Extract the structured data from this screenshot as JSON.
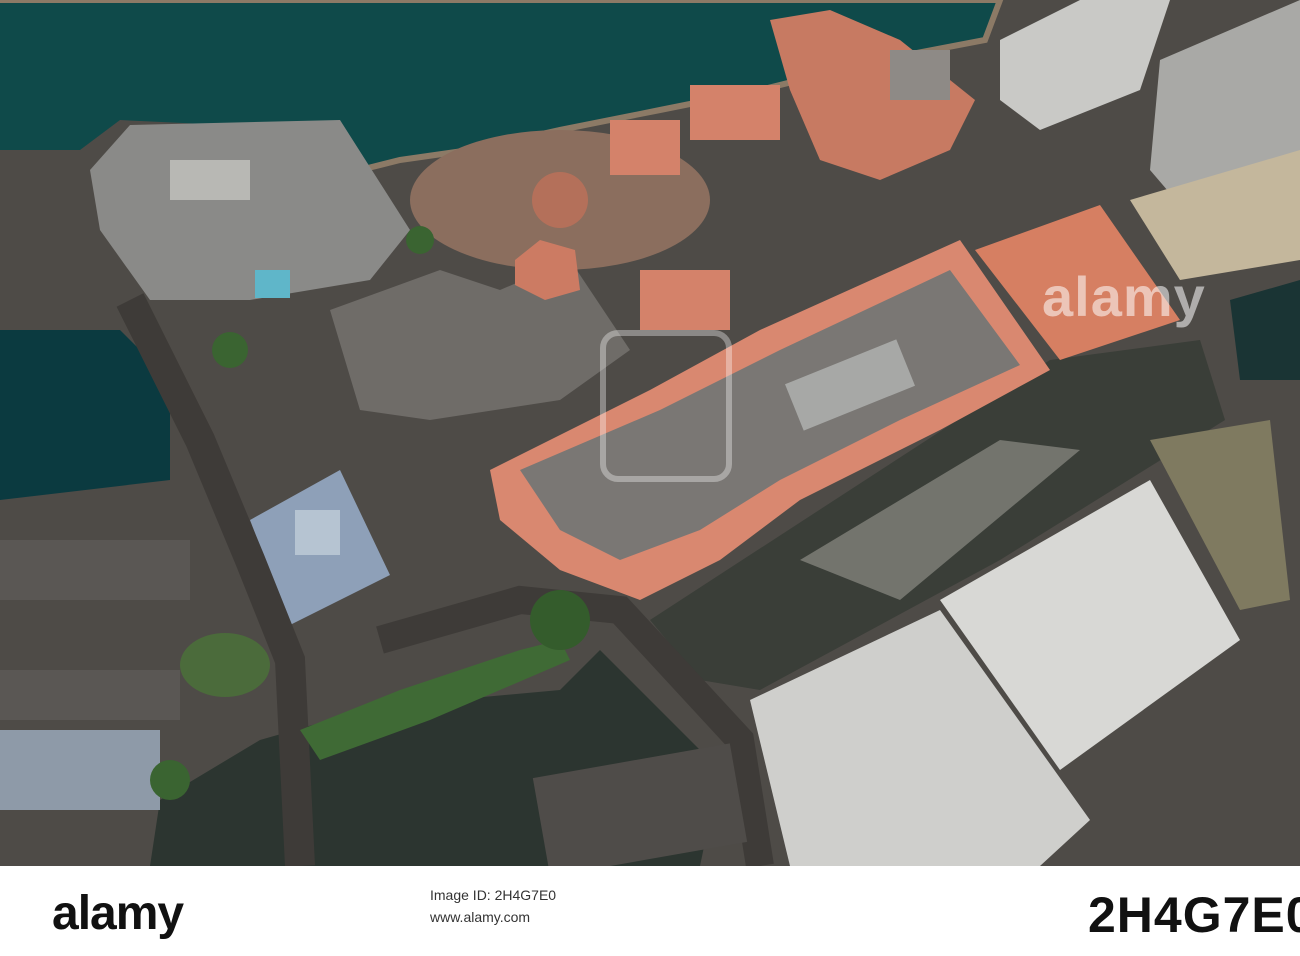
{
  "photo": {
    "subject": "aerial-waterfront-buildings",
    "watermark": "alamy",
    "colors": {
      "sea": "#0f4a4a",
      "roof_pink": "#d98870",
      "roof_grey": "#7d7c78",
      "roof_white": "#d9d9d6",
      "road": "#4a4744",
      "greenery": "#3f6a35"
    }
  },
  "footer": {
    "logo_text": "alamy",
    "image_id_label": "Image ID: 2H4G7E0",
    "site": "www.alamy.com",
    "image_code": "2H4G7E0"
  }
}
